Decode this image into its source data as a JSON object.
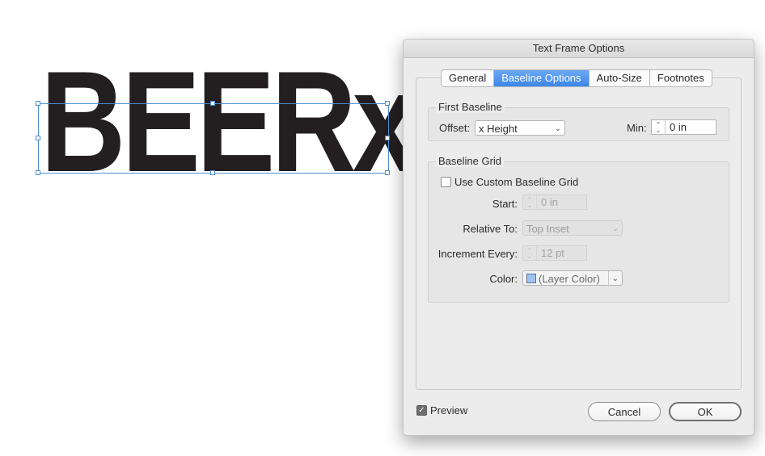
{
  "canvas": {
    "frame_text": "BEERx"
  },
  "dialog": {
    "title": "Text Frame Options",
    "tabs": [
      {
        "label": "General",
        "active": false
      },
      {
        "label": "Baseline Options",
        "active": true
      },
      {
        "label": "Auto-Size",
        "active": false
      },
      {
        "label": "Footnotes",
        "active": false
      }
    ],
    "first_baseline": {
      "title": "First Baseline",
      "offset_label": "Offset:",
      "offset_value": "x Height",
      "min_label": "Min:",
      "min_value": "0 in"
    },
    "baseline_grid": {
      "title": "Baseline Grid",
      "use_custom_label": "Use Custom Baseline Grid",
      "use_custom_checked": false,
      "start_label": "Start:",
      "start_value": "0 in",
      "relative_to_label": "Relative To:",
      "relative_to_value": "Top Inset",
      "increment_label": "Increment Every:",
      "increment_value": "12 pt",
      "color_label": "Color:",
      "color_value": "(Layer Color)",
      "color_swatch": "#9ec3f2"
    },
    "preview_label": "Preview",
    "preview_checked": true,
    "cancel_label": "Cancel",
    "ok_label": "OK"
  },
  "colors": {
    "selection": "#4a8fd4",
    "tab_active": "#3d86e8",
    "frame_text": "#231f20"
  }
}
